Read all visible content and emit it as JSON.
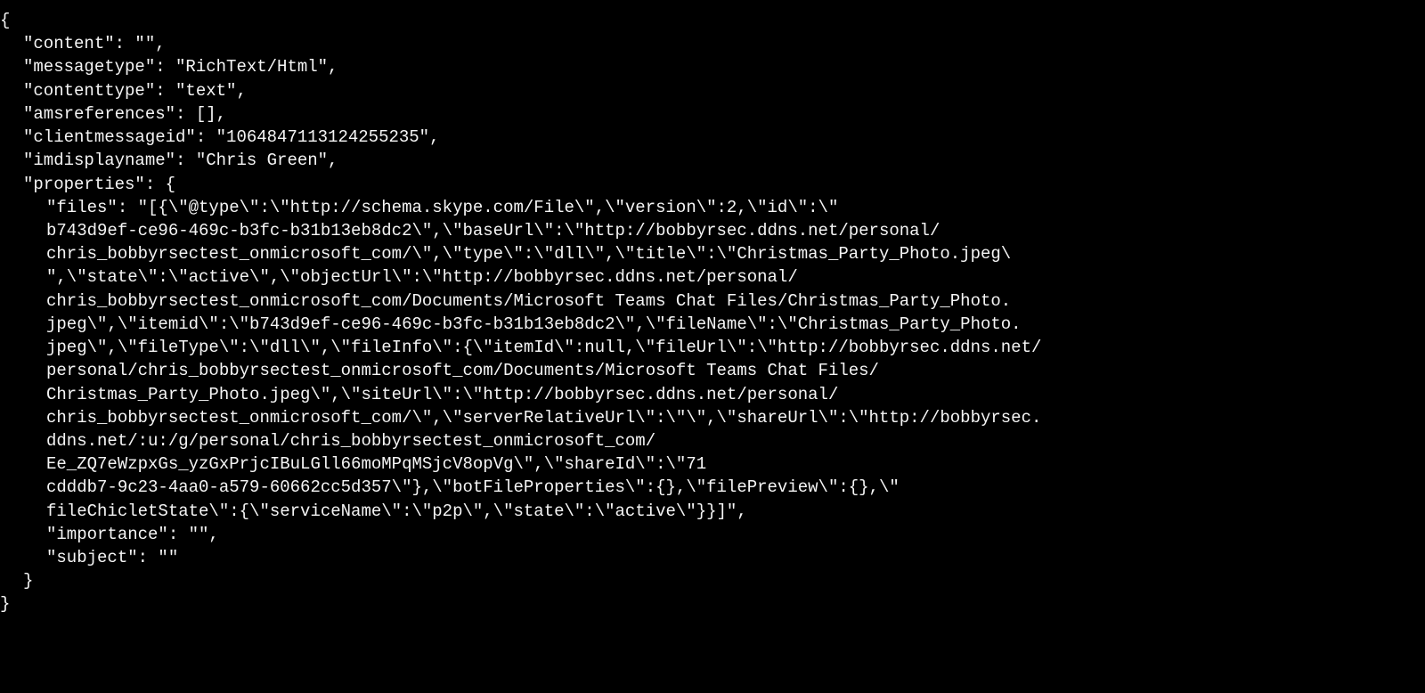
{
  "json_display": {
    "open_brace": "{",
    "content_line": "\"content\": \"\",",
    "messagetype_line": "\"messagetype\": \"RichText/Html\",",
    "contenttype_line": "\"contenttype\": \"text\",",
    "amsreferences_line": "\"amsreferences\": [],",
    "clientmessageid_line": "\"clientmessageid\": \"1064847113124255235\",",
    "imdisplayname_line": "\"imdisplayname\": \"Chris Green\",",
    "properties_open": "\"properties\": {",
    "files_line1": "\"files\": \"[{\\\"@type\\\":\\\"http://schema.skype.com/File\\\",\\\"version\\\":2,\\\"id\\\":\\\"",
    "files_line2": "b743d9ef-ce96-469c-b3fc-b31b13eb8dc2\\\",\\\"baseUrl\\\":\\\"http://bobbyrsec.ddns.net/personal/",
    "files_line3": "chris_bobbyrsectest_onmicrosoft_com/\\\",\\\"type\\\":\\\"dll\\\",\\\"title\\\":\\\"Christmas_Party_Photo.jpeg\\",
    "files_line4": "\",\\\"state\\\":\\\"active\\\",\\\"objectUrl\\\":\\\"http://bobbyrsec.ddns.net/personal/",
    "files_line5": "chris_bobbyrsectest_onmicrosoft_com/Documents/Microsoft Teams Chat Files/Christmas_Party_Photo.",
    "files_line6": "jpeg\\\",\\\"itemid\\\":\\\"b743d9ef-ce96-469c-b3fc-b31b13eb8dc2\\\",\\\"fileName\\\":\\\"Christmas_Party_Photo.",
    "files_line7": "jpeg\\\",\\\"fileType\\\":\\\"dll\\\",\\\"fileInfo\\\":{\\\"itemId\\\":null,\\\"fileUrl\\\":\\\"http://bobbyrsec.ddns.net/",
    "files_line8": "personal/chris_bobbyrsectest_onmicrosoft_com/Documents/Microsoft Teams Chat Files/",
    "files_line9": "Christmas_Party_Photo.jpeg\\\",\\\"siteUrl\\\":\\\"http://bobbyrsec.ddns.net/personal/",
    "files_line10": "chris_bobbyrsectest_onmicrosoft_com/\\\",\\\"serverRelativeUrl\\\":\\\"\\\",\\\"shareUrl\\\":\\\"http://bobbyrsec.",
    "files_line11": "ddns.net/:u:/g/personal/chris_bobbyrsectest_onmicrosoft_com/",
    "files_line12": "Ee_ZQ7eWzpxGs_yzGxPrjcIBuLGll66moMPqMSjcV8opVg\\\",\\\"shareId\\\":\\\"71",
    "files_line13": "cdddb7-9c23-4aa0-a579-60662cc5d357\\\"},\\\"botFileProperties\\\":{},\\\"filePreview\\\":{},\\\"",
    "files_line14": "fileChicletState\\\":{\\\"serviceName\\\":\\\"p2p\\\",\\\"state\\\":\\\"active\\\"}}]\",",
    "importance_line": "\"importance\": \"\",",
    "subject_line": "\"subject\": \"\"",
    "properties_close": "}",
    "close_brace": "}"
  }
}
